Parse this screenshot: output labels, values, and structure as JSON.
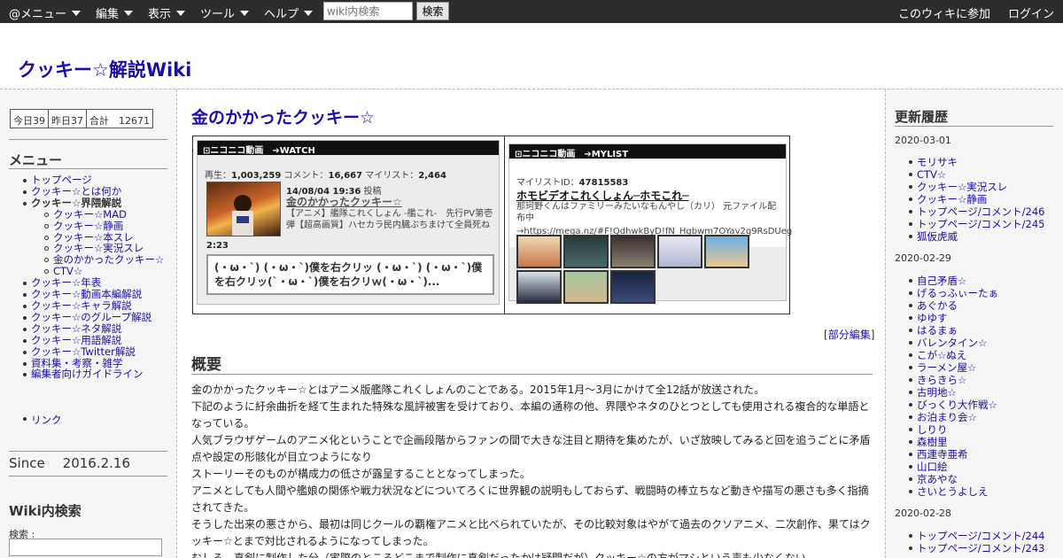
{
  "topbar": {
    "menus": [
      "@メニュー",
      "編集",
      "表示",
      "ツール",
      "ヘルプ"
    ],
    "search_placeholder": "wiki内検索",
    "search_button": "検索",
    "join": "このウィキに参加",
    "login": "ログイン"
  },
  "site_title": "クッキー☆解説Wiki",
  "left": {
    "counter": {
      "today": "今日39",
      "yesterday": "昨日37",
      "total": "合計　12671"
    },
    "menu_heading": "メニュー",
    "menu": [
      {
        "label": "トップページ",
        "level": 0
      },
      {
        "label": "クッキー☆とは何か",
        "level": 0
      },
      {
        "label": "クッキー☆界隈解説",
        "level": 0,
        "bold": true
      },
      {
        "label": "クッキー☆MAD",
        "level": 1
      },
      {
        "label": "クッキー☆静画",
        "level": 1
      },
      {
        "label": "クッキー☆本スレ",
        "level": 1
      },
      {
        "label": "クッキー☆実況スレ",
        "level": 1
      },
      {
        "label": "金のかかったクッキー☆",
        "level": 1
      },
      {
        "label": "CTV☆",
        "level": 1
      },
      {
        "label": "クッキー☆年表",
        "level": 0
      },
      {
        "label": "クッキー☆動画本編解説",
        "level": 0
      },
      {
        "label": "クッキー☆キャラ解説",
        "level": 0
      },
      {
        "label": "クッキー☆のグループ解説",
        "level": 0
      },
      {
        "label": "クッキー☆ネタ解説",
        "level": 0
      },
      {
        "label": "クッキー☆用語解説",
        "level": 0
      },
      {
        "label": "クッキー☆Twitter解説",
        "level": 0
      },
      {
        "label": "資料集・考察・雑学",
        "level": 0
      },
      {
        "label": "編集者向けガイドライン",
        "level": 0
      }
    ],
    "links": [
      "リンク"
    ],
    "since_label": "Since",
    "since_date": "2016.2.16",
    "search_heading": "Wiki内検索",
    "search_label": "検索 :"
  },
  "main": {
    "page_title": "金のかかったクッキー☆",
    "watch": {
      "brand": "⊡ニコニコ動画　➔WATCH",
      "views_label": "再生：",
      "views": "1,003,259",
      "comments_label": "コメント：",
      "comments": "16,667",
      "mylist_label": "マイリスト：",
      "mylist": "2,464",
      "date": "14/08/04 19:36",
      "posted": "投稿",
      "title": "金のかかったクッキー☆",
      "desc": "【アニメ】艦隊これくしょん -艦これ-　先行PV第壱弾【超高画質】ハセカラ民内臓ぶちまけて全員死ね",
      "length": "2:23",
      "comment": "(・ω・`) (・ω・`)僕を右クリッ (・ω・`) (・ω・`)僕を右クリッ(`・ω・`)僕を右クリｗ(・ω・`)..."
    },
    "mylist": {
      "brand": "⊡ニコニコ動画　➔MYLIST",
      "id_label": "マイリストID：",
      "id": "47815583",
      "title": "ホモビデオこれくしょん─ホモこれ─",
      "desc": "那珂野くんはファミリーみたいなもんやし（カリ） 元ファイル配布中",
      "url": "→https://mega.nz/#F!QdhwkByD!fN_Hgbwm7OYav2q9RsDUeg"
    },
    "edit_open": "[",
    "edit_label": "部分編集",
    "edit_close": "]",
    "section_title": "概要",
    "paragraphs": [
      "金のかかったクッキー☆とはアニメ版艦隊これくしょんのことである。2015年1月～3月にかけて全12話が放送された。",
      "下記のように紆余曲折を経て生まれた特殊な風評被害を受けており、本編の通称の他、界隈やネタのひとつとしても使用される複合的な単語となっている。",
      "人気ブラウザゲームのアニメ化ということで企画段階からファンの間で大きな注目と期待を集めたが、いざ放映してみると回を追うごとに矛盾点や設定の形骸化が目立つようになり",
      "ストーリーそのものが構成力の低さが露呈することとなってしまった。",
      "アニメとしても人間や艦娘の関係や戦力状況などについてろくに世界観の説明もしておらず、戦闘時の棒立ちなど動きや描写の悪さも多く指摘されてきた。",
      "そうした出来の悪さから、最初は同じクールの覇権アニメと比べられていたが、その比較対象はやがて過去のクソアニメ、二次創作、果てはクッキー☆とまで対比されるようになってしまった。",
      "むしろ、真剣に制作した分（実際のところどこまで制作に真剣だったかは疑問だが）クッキー☆の方がマシという声も少なくない。"
    ]
  },
  "right": {
    "heading": "更新履歴",
    "groups": [
      {
        "date": "2020-03-01",
        "items": [
          "モリサキ",
          "CTV☆",
          "クッキー☆実況スレ",
          "クッキー☆静画",
          "トップページ/コメント/246",
          "トップページ/コメント/245",
          "狐仮虎威"
        ]
      },
      {
        "date": "2020-02-29",
        "items": [
          "自己矛盾☆",
          "げるっふぃーたぁ",
          "あぐかる",
          "ゆゆす",
          "はるまぁ",
          "バレンタイン☆",
          "こが☆ぬえ",
          "ラーメン屋☆",
          "きらきら☆",
          "古明地☆",
          "びっくり大作戦☆",
          "お泊まり会☆",
          "しりり",
          "森樹里",
          "西連寺亜希",
          "山口絵",
          "京あやな",
          "さいとうよしえ"
        ]
      },
      {
        "date": "2020-02-28",
        "items": [
          "トップページ/コメント/244",
          "トップページ/コメント/243"
        ]
      }
    ]
  }
}
